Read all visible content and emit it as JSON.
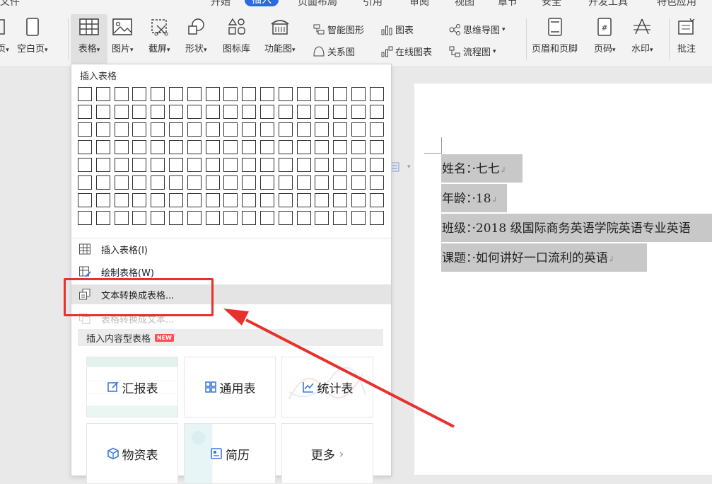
{
  "menu": {
    "tabs": [
      "文件",
      "开始",
      "插入",
      "页面布局",
      "引用",
      "审阅",
      "视图",
      "章节",
      "安全",
      "开发工具",
      "特色应用"
    ],
    "active_tab": "插入"
  },
  "ribbon": {
    "page_partial": "页",
    "blank_page": "空白页",
    "table": "表格",
    "picture": "图片",
    "screenshot": "截屏",
    "shape": "形状",
    "icon_lib": "图标库",
    "function_chart": "功能图",
    "smart_graphic": "智能图形",
    "chart": "图表",
    "relation_chart": "关系图",
    "online_chart": "在线图表",
    "mindmap": "思维导图",
    "flowchart": "流程图",
    "header_footer": "页眉和页脚",
    "page_number": "页码",
    "watermark": "水印",
    "comment": "批注"
  },
  "dropdown": {
    "title": "插入表格",
    "grid_cols": 17,
    "grid_rows": 8,
    "items": {
      "insert_table": "插入表格(I)",
      "draw_table": "绘制表格(W)",
      "text_to_table": "文本转换成表格...",
      "table_to_text": "表格转换成文本..."
    },
    "content_section": "插入内容型表格",
    "new_badge": "NEW",
    "cards": {
      "report": "汇报表",
      "general": "通用表",
      "statistics": "统计表",
      "materials": "物资表",
      "resume": "简历",
      "more": "更多"
    }
  },
  "document": {
    "lines": [
      "姓名：·七七",
      "年龄：·18",
      "班级：·2018 级国际商务英语学院英语专业英语",
      "课题：·如何讲好一口流利的英语"
    ],
    "para_mark": "↲"
  },
  "colors": {
    "accent": "#2b6ae0",
    "annotation_red": "#e8312d",
    "highlight": "#c8c8c8"
  }
}
